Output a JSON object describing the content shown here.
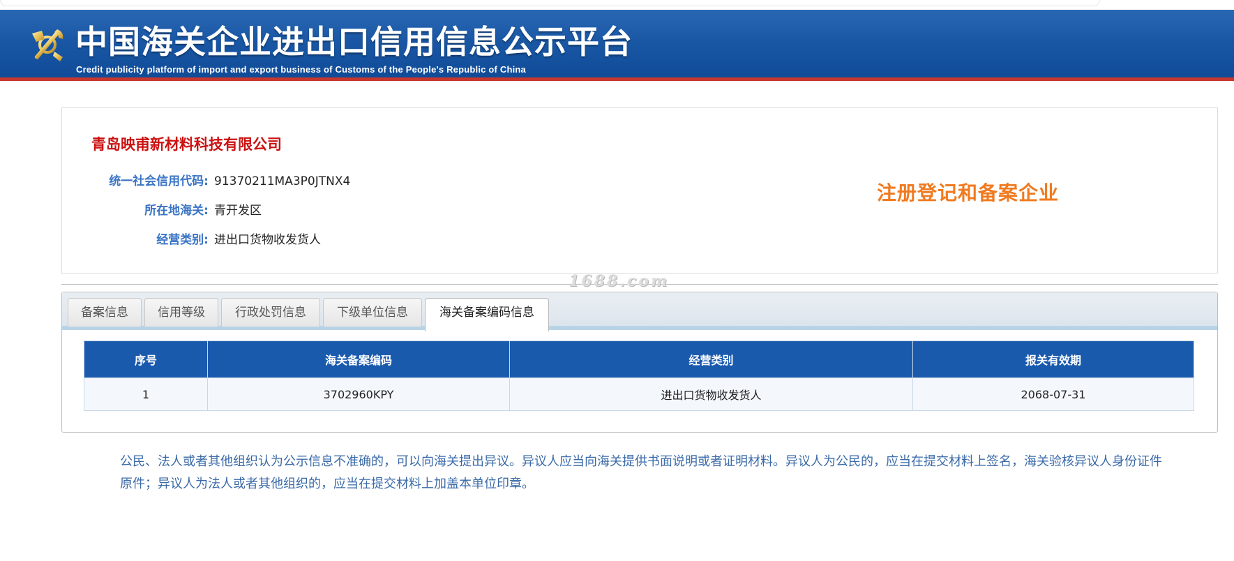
{
  "header": {
    "title": "中国海关企业进出口信用信息公示平台",
    "subtitle": "Credit publicity platform of import and export business of Customs of the People's Republic of China",
    "logo_icon": "customs-emblem-icon"
  },
  "company": {
    "name": "青岛映甫新材料科技有限公司",
    "fields": [
      {
        "label": "统一社会信用代码:",
        "value": "91370211MA3P0JTNX4"
      },
      {
        "label": "所在地海关:",
        "value": "青开发区"
      },
      {
        "label": "经营类别:",
        "value": "进出口货物收发货人"
      }
    ],
    "stamp": "注册登记和备案企业"
  },
  "watermark": "1688.com",
  "tabs": [
    {
      "label": "备案信息"
    },
    {
      "label": "信用等级"
    },
    {
      "label": "行政处罚信息"
    },
    {
      "label": "下级单位信息"
    },
    {
      "label": "海关备案编码信息"
    }
  ],
  "table": {
    "headers": [
      "序号",
      "海关备案编码",
      "经营类别",
      "报关有效期"
    ],
    "rows": [
      [
        "1",
        "3702960KPY",
        "进出口货物收发货人",
        "2068-07-31"
      ]
    ]
  },
  "notice": "公民、法人或者其他组织认为公示信息不准确的，可以向海关提出异议。异议人应当向海关提供书面说明或者证明材料。异议人为公民的，应当在提交材料上签名，海关验核异议人身份证件原件；异议人为法人或者其他组织的，应当在提交材料上加盖本单位印章。",
  "colors": {
    "header_blue": "#1957a5",
    "accent_red": "#c8372d",
    "label_blue": "#3a74c4",
    "company_red": "#cc1111",
    "stamp_orange": "#f07a1f",
    "table_header": "#1a5aad"
  }
}
